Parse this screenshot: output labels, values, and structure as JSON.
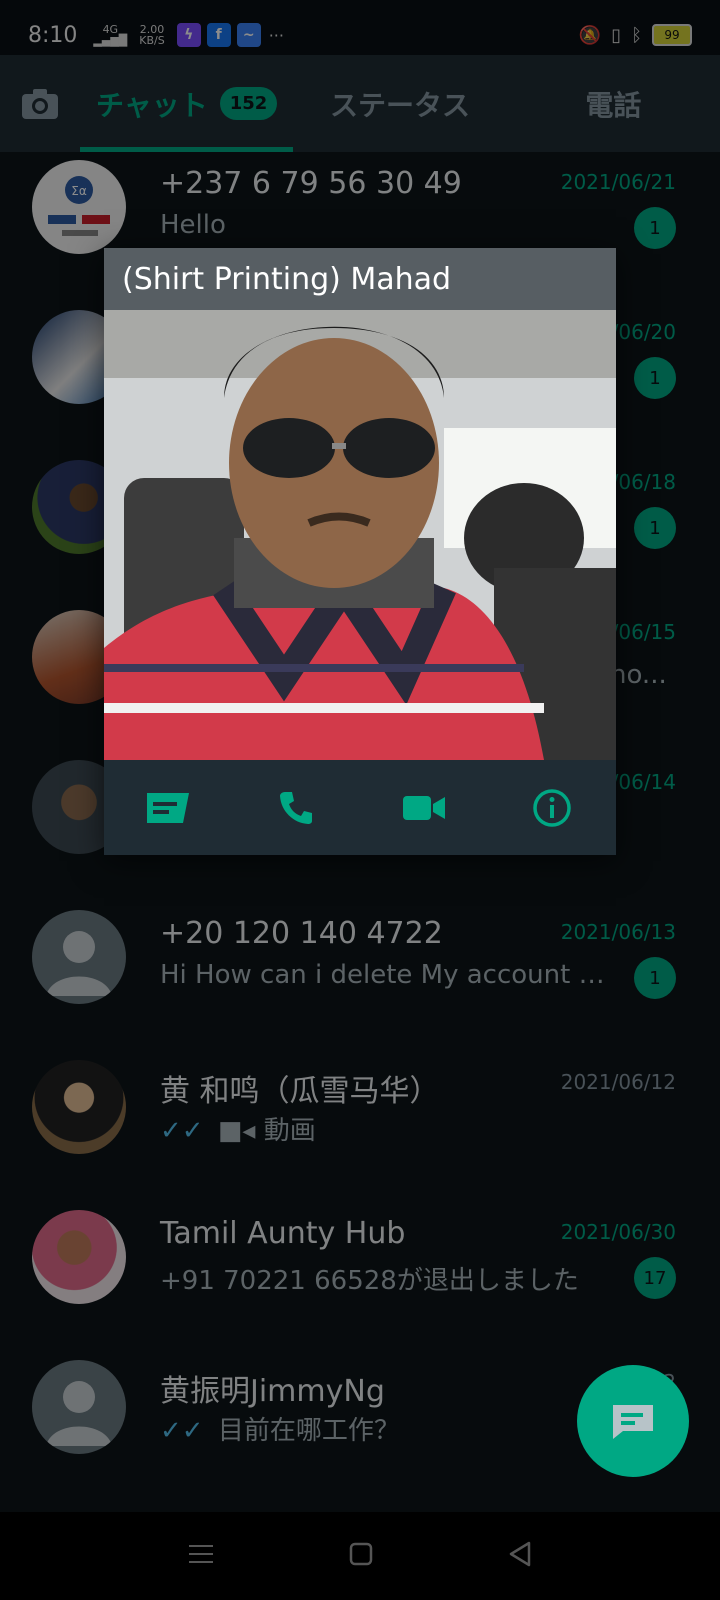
{
  "status_bar": {
    "time": "8:10",
    "network_type": "4G",
    "speed_value": "2.00",
    "speed_unit": "KB/S",
    "more": "···",
    "battery": "99"
  },
  "tabs": [
    {
      "label": "チャット",
      "badge": "152",
      "active": true
    },
    {
      "label": "ステータス",
      "active": false
    },
    {
      "label": "電話",
      "active": false
    }
  ],
  "chats": [
    {
      "name": "+237 6 79 56 30 49",
      "message": "Hello",
      "date": "2021/06/21",
      "unread": "1"
    },
    {
      "name": "",
      "message": "",
      "date": "/06/20",
      "unread": "1"
    },
    {
      "name": "",
      "message": "",
      "date": "/06/18",
      "unread": "1"
    },
    {
      "name": "",
      "message": "no...",
      "date": "/06/15",
      "unread": ""
    },
    {
      "name": "",
      "message": "",
      "date": "/06/14",
      "unread": ""
    },
    {
      "name": "+20 120 140 4722",
      "message": "Hi How can i delete My account i...",
      "date": "2021/06/13",
      "unread": "1"
    },
    {
      "name": "黄 和鸣（瓜雪马华）",
      "message": "動画",
      "date": "2021/06/12",
      "unread": ""
    },
    {
      "name": "Tamil Aunty Hub",
      "message": "+91 70221 66528が退出しました",
      "date": "2021/06/30",
      "unread": "17"
    },
    {
      "name": "黄振明JimmyNg",
      "message": "目前在哪工作？",
      "date": "2",
      "unread": ""
    }
  ],
  "popup": {
    "title": "(Shirt Printing) Mahad"
  },
  "colors": {
    "accent": "#00a884",
    "background": "#0d1418",
    "header": "#1f2c34",
    "read_ticks": "#53bdeb"
  }
}
